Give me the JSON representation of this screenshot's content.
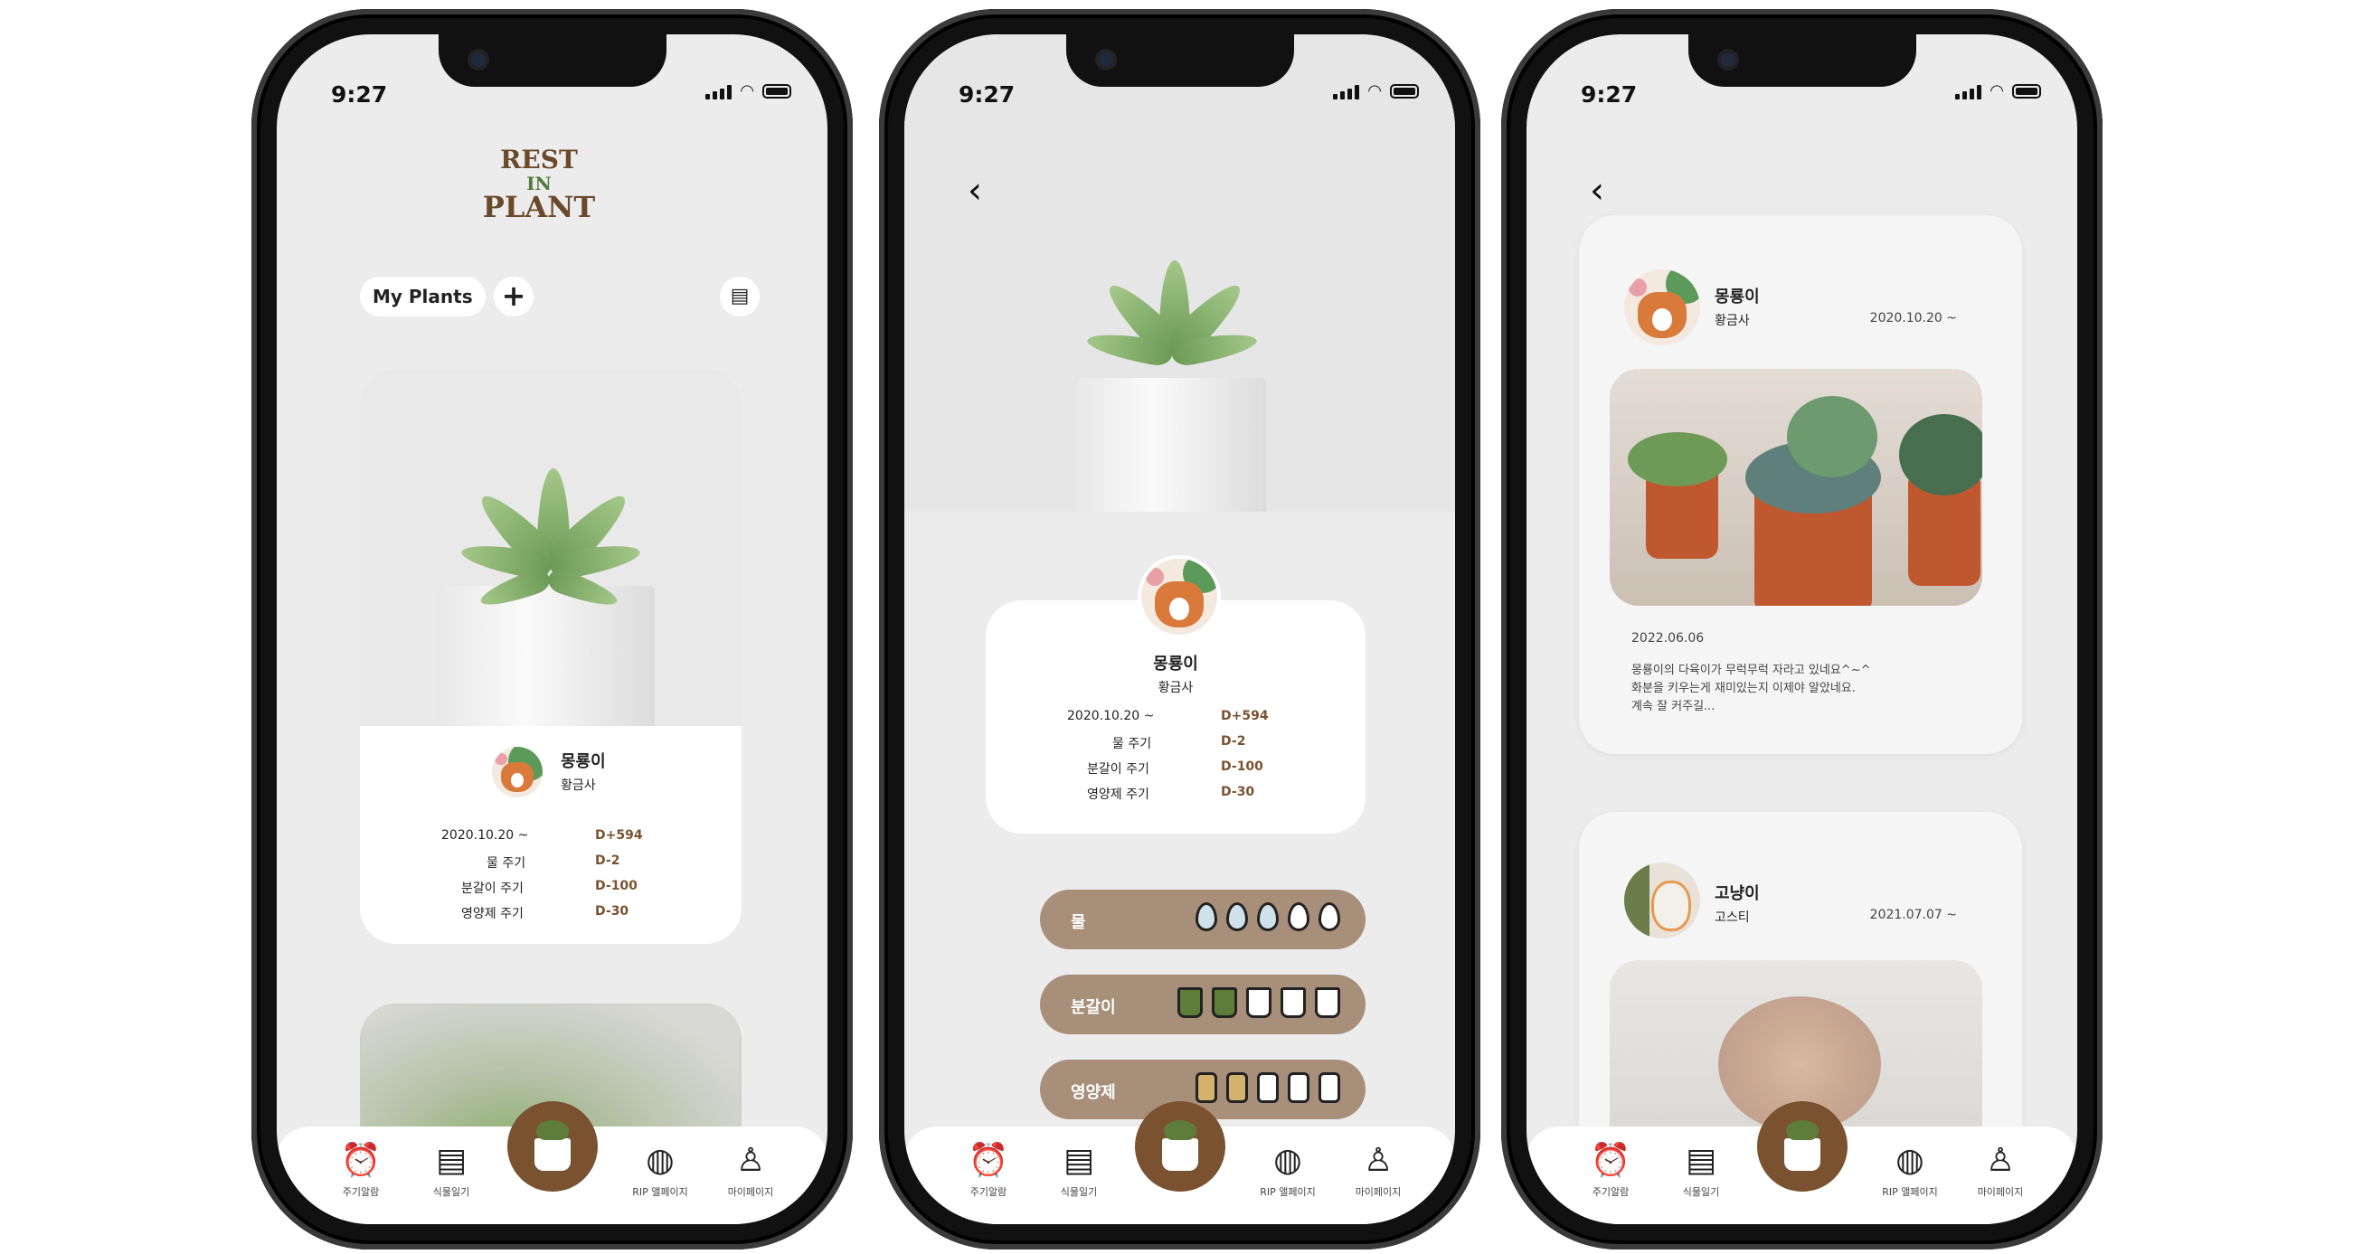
{
  "status": {
    "time": "9:27"
  },
  "logo": {
    "line1": "REST",
    "line2": "IN",
    "line3": "PLANT"
  },
  "home": {
    "my_plants_label": "My Plants",
    "add_icon": "plus-icon",
    "list_icon": "notebook-icon"
  },
  "plant": {
    "name": "몽룡이",
    "species": "황금사",
    "start": "2020.10.20 ~",
    "rows": [
      {
        "label": "2020.10.20 ~",
        "value": "D+594"
      },
      {
        "label": "물 주기",
        "value": "D-2"
      },
      {
        "label": "분갈이 주기",
        "value": "D-100"
      },
      {
        "label": "영양제 주기",
        "value": "D-30"
      }
    ]
  },
  "care": [
    {
      "label": "물",
      "icon": "water-drop-icon",
      "filled": 3,
      "total": 5
    },
    {
      "label": "분갈이",
      "icon": "pot-icon",
      "filled": 2,
      "total": 5
    },
    {
      "label": "영양제",
      "icon": "jar-icon",
      "filled": 2,
      "total": 5
    }
  ],
  "diary": [
    {
      "name": "몽룡이",
      "species": "황금사",
      "date": "2020.10.20 ~",
      "entry_date": "2022.06.06",
      "text1": "몽룡이의 다육이가 무럭무럭 자라고 있네요^~^",
      "text2": "화분을 키우는게 재미있는지 이제야 알았네요.",
      "text3": "계속 잘 커주길..."
    },
    {
      "name": "고냥이",
      "species": "고스티",
      "date": "2021.07.07 ~"
    }
  ],
  "tabs": [
    {
      "label": "주기알람",
      "icon": "alarm-clock-icon"
    },
    {
      "label": "식물일기",
      "icon": "notebook-icon"
    },
    {
      "label": "RIP 앨페이지",
      "icon": "globe-icon"
    },
    {
      "label": "마이페이지",
      "icon": "person-icon"
    }
  ],
  "colors": {
    "brown": "#7b5230",
    "care_pill": "#a78f7a",
    "screen_bg": "#ececec"
  }
}
